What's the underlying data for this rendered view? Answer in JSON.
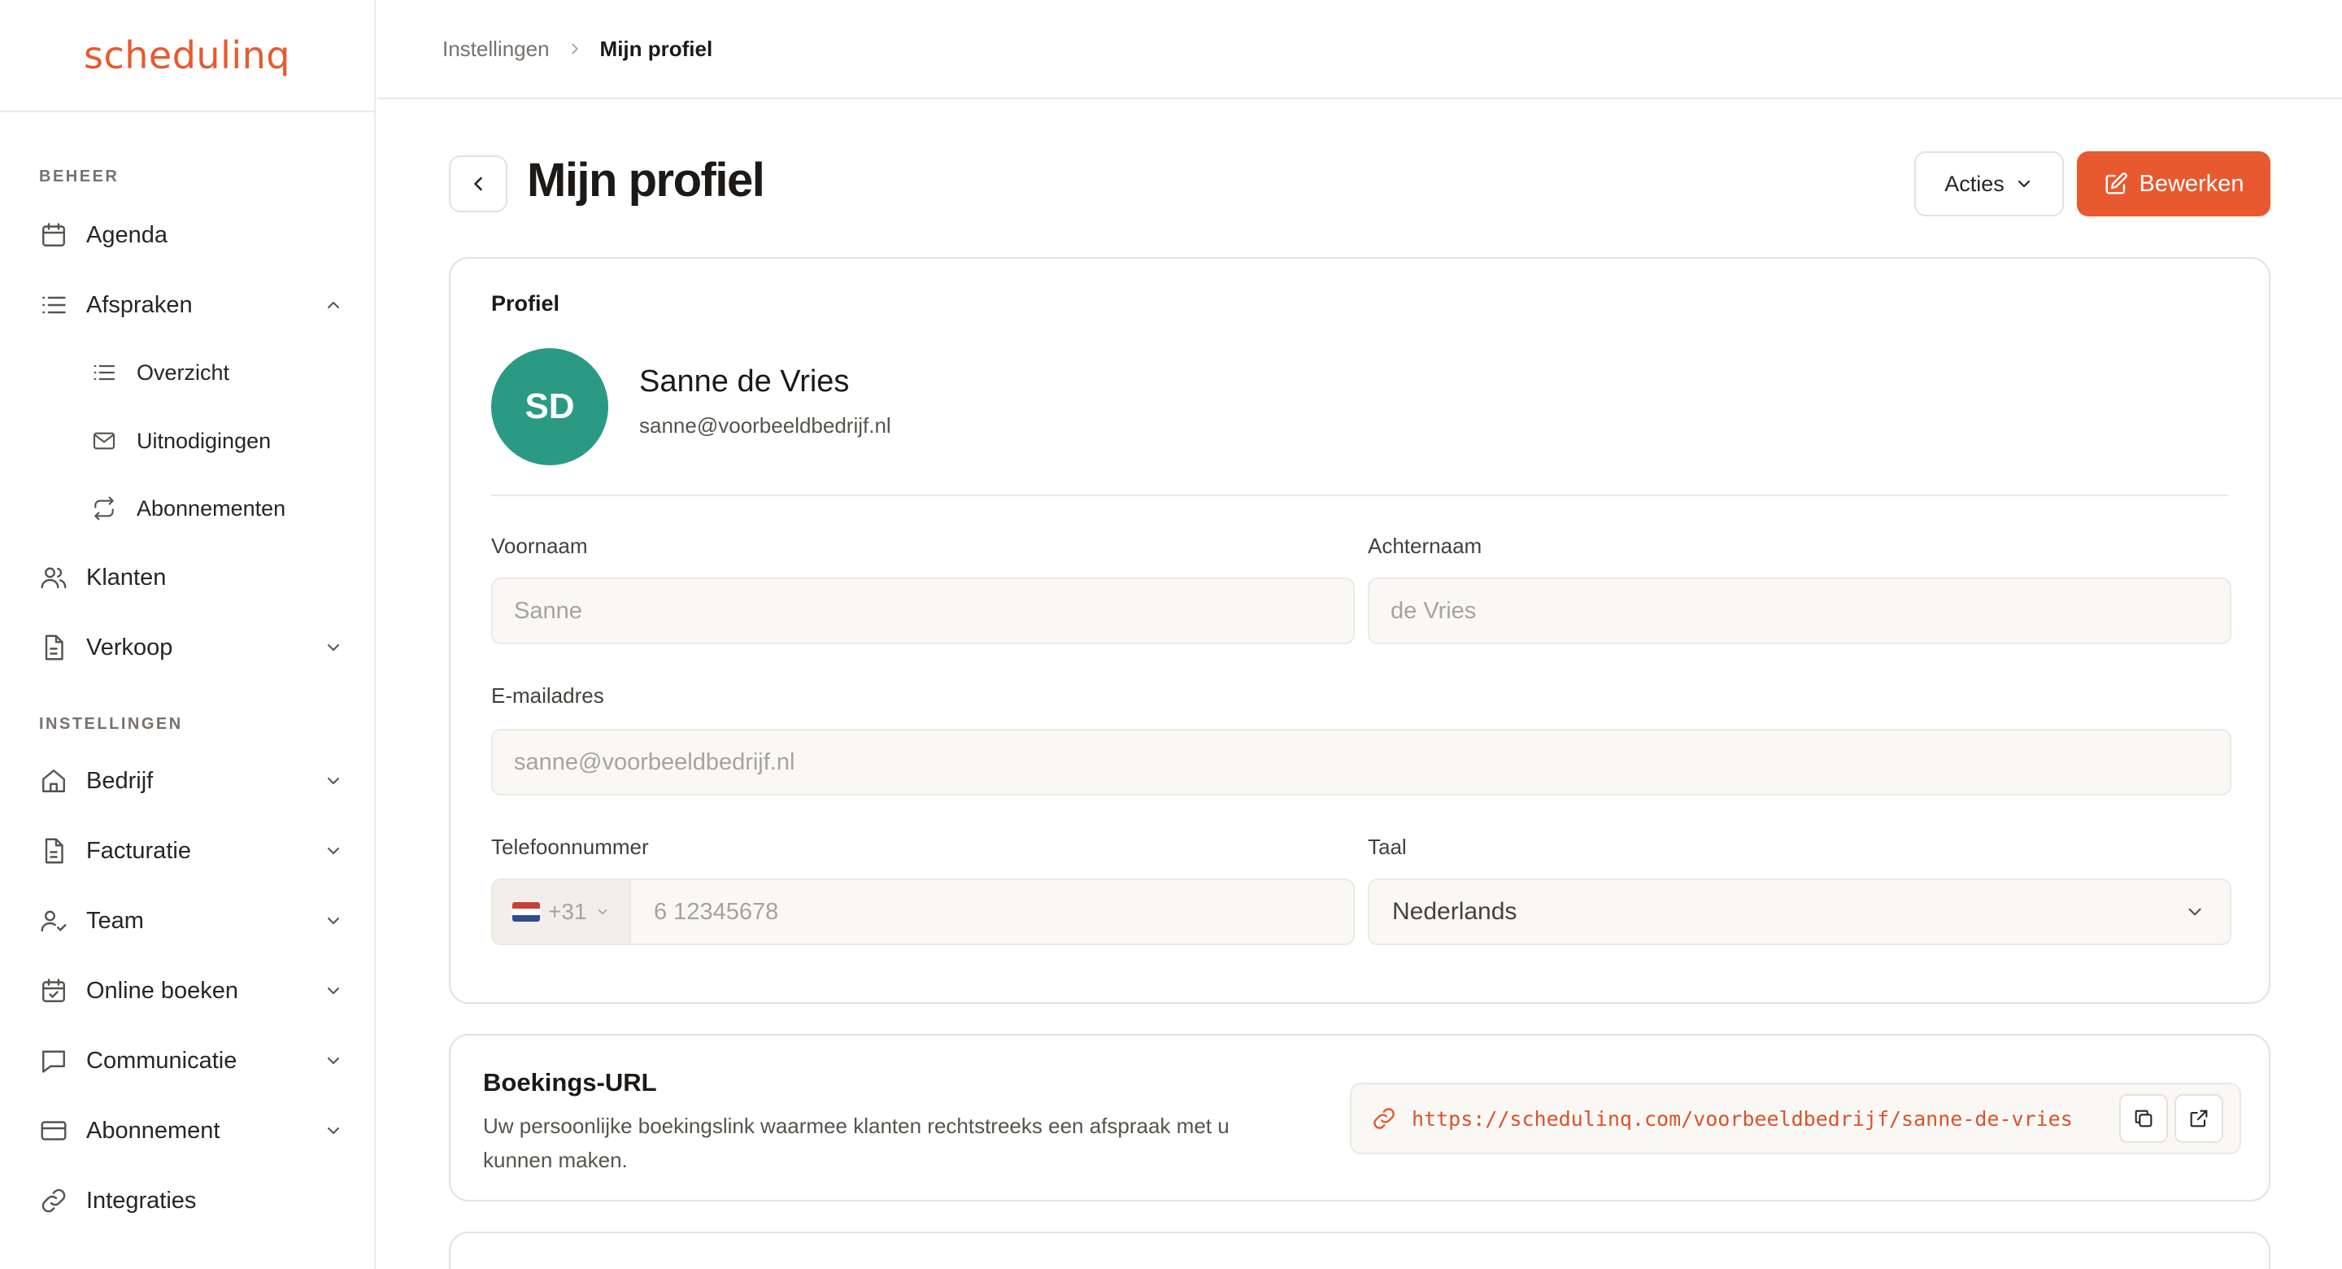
{
  "app": {
    "logo": "schedulinq"
  },
  "colors": {
    "accent": "#e8592f",
    "avatar": "#2a9a85",
    "flag_red": "#c7403a",
    "flag_white": "#ffffff",
    "flag_blue": "#2f4d8f"
  },
  "sidebar": {
    "section_manage": "BEHEER",
    "section_settings": "INSTELLINGEN",
    "items": [
      {
        "label": "Agenda",
        "icon": "calendar-icon"
      },
      {
        "label": "Afspraken",
        "icon": "list-icon",
        "expanded": true
      },
      {
        "label": "Overzicht",
        "icon": "list-icon"
      },
      {
        "label": "Uitnodigingen",
        "icon": "mail-icon"
      },
      {
        "label": "Abonnementen",
        "icon": "repeat-icon"
      },
      {
        "label": "Klanten",
        "icon": "users-icon"
      },
      {
        "label": "Verkoop",
        "icon": "document-icon"
      },
      {
        "label": "Bedrijf",
        "icon": "home-icon"
      },
      {
        "label": "Facturatie",
        "icon": "document-icon"
      },
      {
        "label": "Team",
        "icon": "user-check-icon"
      },
      {
        "label": "Online boeken",
        "icon": "calendar-check-icon"
      },
      {
        "label": "Communicatie",
        "icon": "chat-icon"
      },
      {
        "label": "Abonnement",
        "icon": "card-icon"
      },
      {
        "label": "Integraties",
        "icon": "link-icon"
      }
    ]
  },
  "breadcrumb": {
    "parent": "Instellingen",
    "current": "Mijn profiel"
  },
  "header": {
    "title": "Mijn profiel",
    "actions_label": "Acties",
    "edit_label": "Bewerken"
  },
  "profile": {
    "section_title": "Profiel",
    "initials": "SD",
    "name": "Sanne de Vries",
    "email": "sanne@voorbeeldbedrijf.nl",
    "fields": {
      "first_name_label": "Voornaam",
      "first_name_value": "Sanne",
      "last_name_label": "Achternaam",
      "last_name_value": "de Vries",
      "email_label": "E-mailadres",
      "email_value": "sanne@voorbeeldbedrijf.nl",
      "phone_label": "Telefoonnummer",
      "phone_prefix": "+31",
      "phone_placeholder": "6 12345678",
      "language_label": "Taal",
      "language_value": "Nederlands"
    }
  },
  "booking_url": {
    "title": "Boekings-URL",
    "description": "Uw persoonlijke boekingslink waarmee klanten rechtstreeks een afspraak met u kunnen maken.",
    "url": "https://schedulinq.com/voorbeeldbedrijf/sanne-de-vries"
  }
}
